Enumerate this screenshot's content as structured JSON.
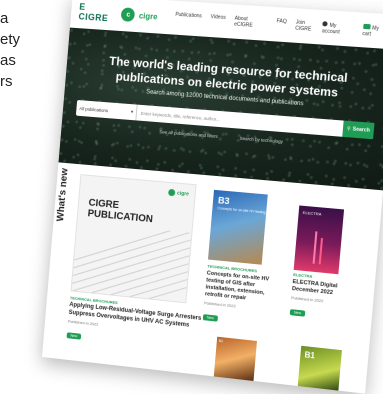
{
  "edge_text": [
    "a",
    "ety",
    "as",
    "rs"
  ],
  "topbar": {
    "logo_text": "E CIGRE",
    "logo_badge": "c",
    "logo_secondary": "cigre",
    "nav": [
      "Publications",
      "Videos",
      "About eCIGRE",
      "FAQ",
      "Join CIGRE"
    ],
    "account": "My account",
    "cart": "My cart"
  },
  "hero": {
    "title_line1": "The world's leading resource for technical",
    "title_line2": "publications on electric power systems",
    "subtitle": "Search among 12000 technical documents and publications",
    "search": {
      "select_value": "All publications",
      "placeholder": "Enter keywords, title, reference, author...",
      "button": "Search"
    },
    "links": [
      "See all publications and filters",
      "Search by technology"
    ]
  },
  "content": {
    "section_title": "What's new",
    "main_card": {
      "logo": "cigre",
      "cover_title_line1": "CIGRE",
      "cover_title_line2": "PUBLICATION",
      "tag": "TECHNICAL BROCHURES",
      "title": "Applying Low-Residual-Voltage Surge Arresters to Suppress Overvoltages in UHV AC Systems",
      "date": "Published in 2022",
      "pill": "New"
    },
    "card_b": {
      "cover_num": "B3",
      "cover_tiny": "Concepts for on-site HV testing",
      "tag": "TECHNICAL BROCHURES",
      "title": "Concepts for on-site HV testing of GIS after installation, extension, retrofit or repair",
      "date": "Published in 2022",
      "pill": "New"
    },
    "card_c": {
      "cover_tiny": "ELECTRA",
      "tag": "ELECTRA",
      "title": "ELECTRA Digital December 2022",
      "date": "Published in 2022",
      "pill": "New"
    },
    "card_d": {
      "cover_tiny": "B2"
    },
    "card_e": {
      "cover_num": "B1"
    }
  }
}
